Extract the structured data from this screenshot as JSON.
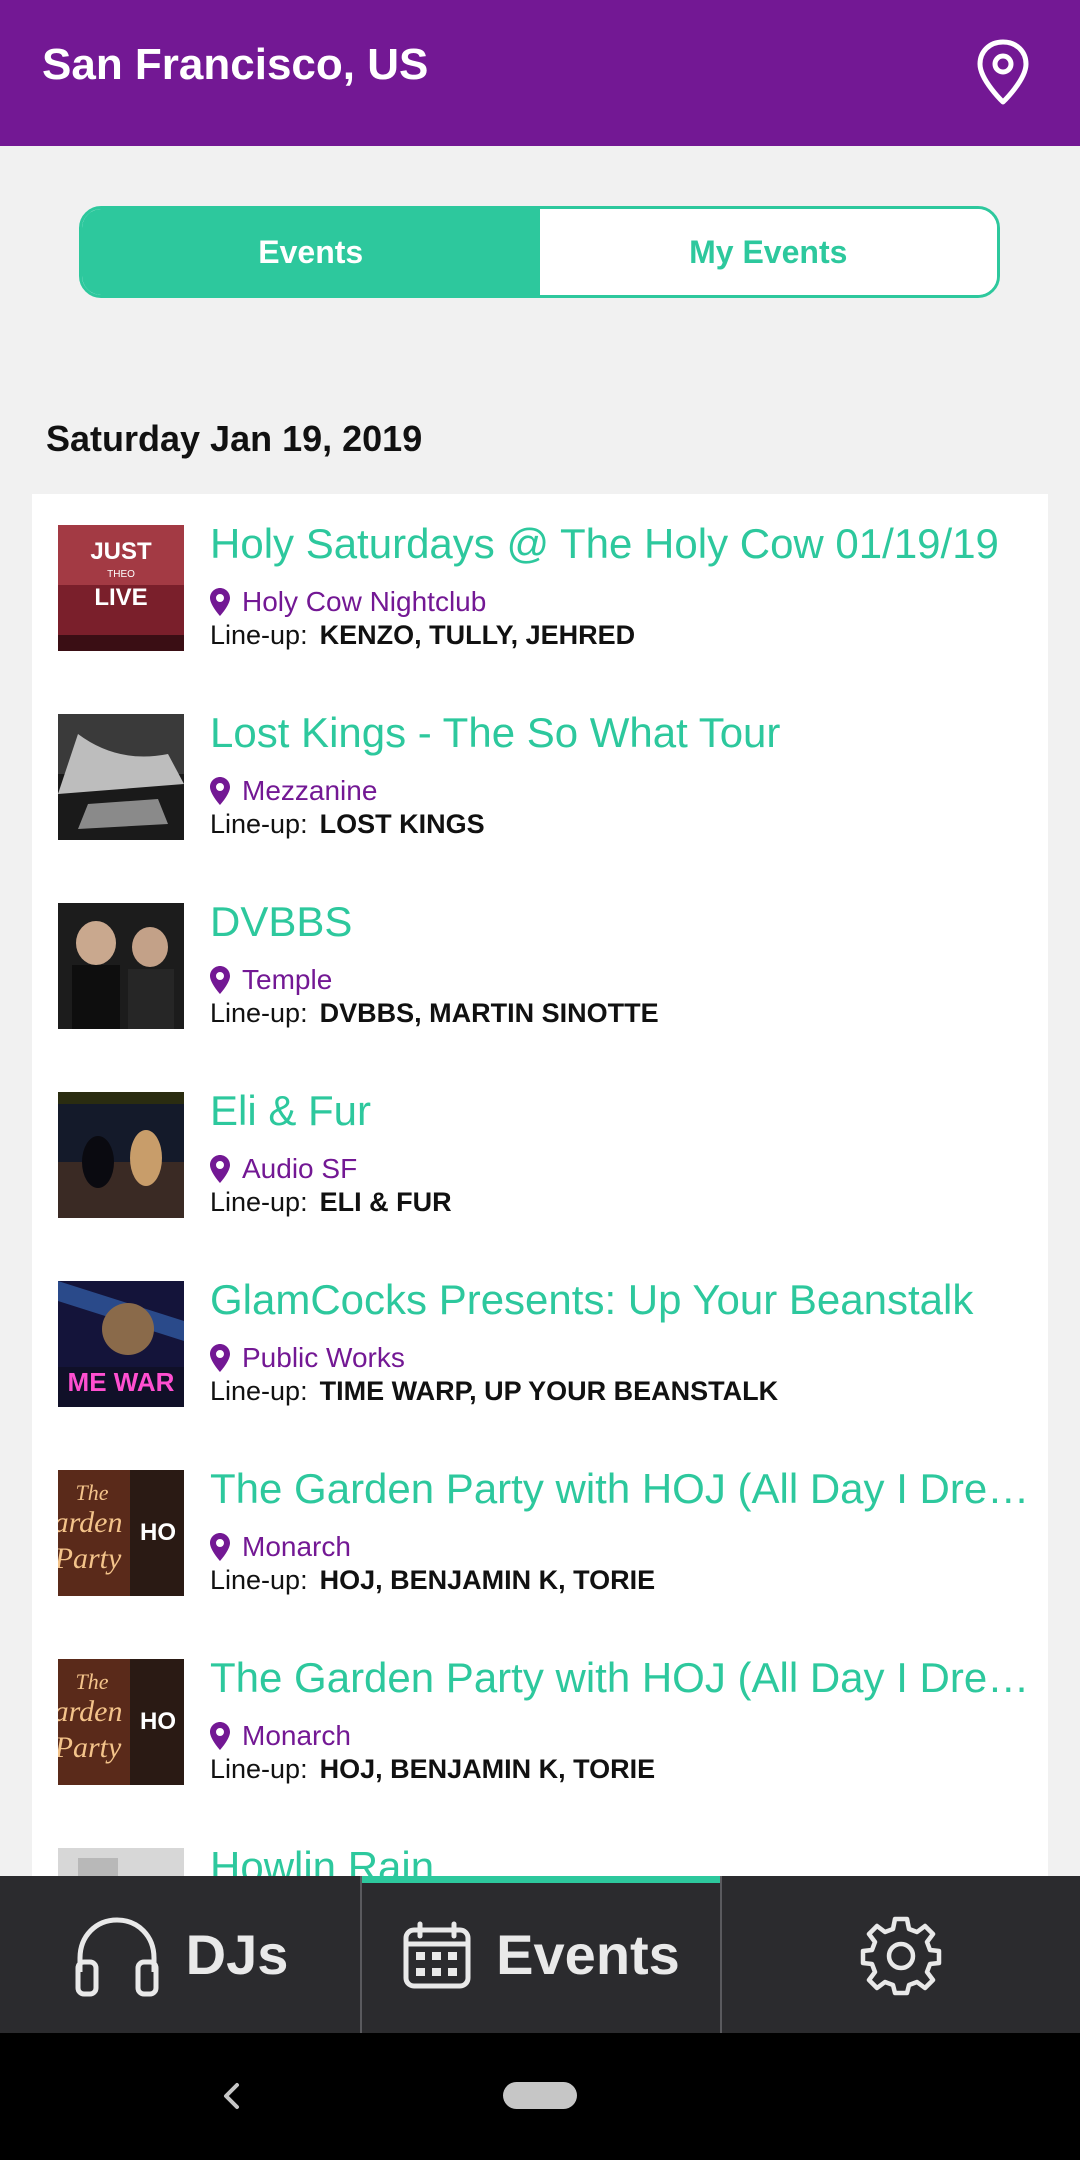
{
  "header": {
    "title": "San Francisco, US",
    "location_icon": "map-pin-icon"
  },
  "segmented": {
    "events_label": "Events",
    "my_events_label": "My Events",
    "active": "Events"
  },
  "date_heading": "Saturday Jan 19, 2019",
  "lineup_label": "Line-up:",
  "events": [
    {
      "title": "Holy Saturdays @ The Holy Cow 01/19/19",
      "venue": "Holy Cow Nightclub",
      "lineup": "KENZO, TULLY, JEHRED",
      "thumb_text_1": "JUST",
      "thumb_text_2": "THEO",
      "thumb_text_3": "LIVE"
    },
    {
      "title": "Lost Kings - The So What Tour",
      "venue": "Mezzanine",
      "lineup": "LOST KINGS"
    },
    {
      "title": "DVBBS",
      "venue": "Temple",
      "lineup": "DVBBS, MARTIN SINOTTE"
    },
    {
      "title": "Eli & Fur",
      "venue": "Audio SF",
      "lineup": "ELI & FUR"
    },
    {
      "title": "GlamCocks Presents: Up Your Beanstalk",
      "venue": "Public Works",
      "lineup": "TIME WARP, UP YOUR BEANSTALK",
      "thumb_text": "ME WAR"
    },
    {
      "title": "The Garden Party with HOJ (All Day I Dre…",
      "venue": "Monarch",
      "lineup": "HOJ, BENJAMIN K, TORIE",
      "thumb_text_1": "The",
      "thumb_text_2": "arden",
      "thumb_text_3": "Party",
      "thumb_text_4": "HO"
    },
    {
      "title": "The Garden Party with HOJ (All Day I Dre…",
      "venue": "Monarch",
      "lineup": "HOJ, BENJAMIN K, TORIE",
      "thumb_text_1": "The",
      "thumb_text_2": "arden",
      "thumb_text_3": "Party",
      "thumb_text_4": "HO"
    },
    {
      "title": "Howlin Rain"
    }
  ],
  "tabbar": [
    {
      "label": "DJs",
      "icon": "headphones-icon"
    },
    {
      "label": "Events",
      "icon": "calendar-icon",
      "active": true
    },
    {
      "label": "",
      "icon": "gear-icon"
    }
  ],
  "colors": {
    "brand_purple": "#731894",
    "accent_green": "#2dc89d",
    "tabbar_bg": "#2b2b2e"
  }
}
